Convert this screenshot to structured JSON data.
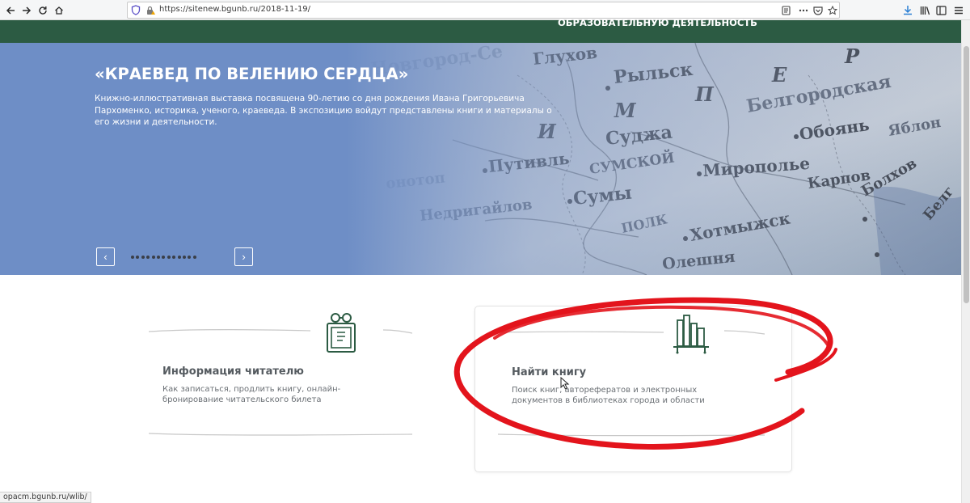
{
  "browser": {
    "url": "https://sitenew.bgunb.ru/2018-11-19/",
    "status_url": "opacm.bgunb.ru/wlib/"
  },
  "header": {
    "nav_item": "ОБРАЗОВАТЕЛЬНУЮ ДЕЯТЕЛЬНОСТЬ",
    "color": "#2c5b43"
  },
  "hero": {
    "title": "«КРАЕВЕД ПО ВЕЛЕНИЮ СЕРДЦА»",
    "description": "Книжно-иллюстративная выставка посвящена 90-летию со дня рождения Ивана Григорьевича Пархоменко, историка, ученого, краеведа. В экспозицию войдут представлены книги и материалы о его жизни и деятельности.",
    "prev_label": "‹",
    "next_label": "›",
    "slide_count": 13,
    "map_labels": [
      "Новгород-Се",
      "Глухов",
      "Р",
      "Рыльск",
      "П",
      "Е",
      "Белгородская",
      "М",
      "Обоянь",
      "Яблон",
      "И",
      "Суджа",
      "Путивль",
      "Пол",
      "Сумской",
      "Миропол",
      "Миропольe",
      "Карпов",
      "Нелригайлов",
      "Сумы",
      "Болхов",
      "Белг",
      "Хотмыжск",
      "Полк",
      "Олешня",
      "онотоп"
    ],
    "color": "#6e8ec6"
  },
  "cards": [
    {
      "title": "Информация читателю",
      "description": "Как записаться, продлить книгу, онлайн-бронирование читательского билета",
      "icon": "reader-card-icon"
    },
    {
      "title": "Найти книгу",
      "description": "Поиск книг, авторефератов и электронных документов в библиотеках города и области",
      "icon": "bookshelf-icon"
    }
  ],
  "accent_color": "#2c5b43",
  "annotation_color": "#e3141c"
}
